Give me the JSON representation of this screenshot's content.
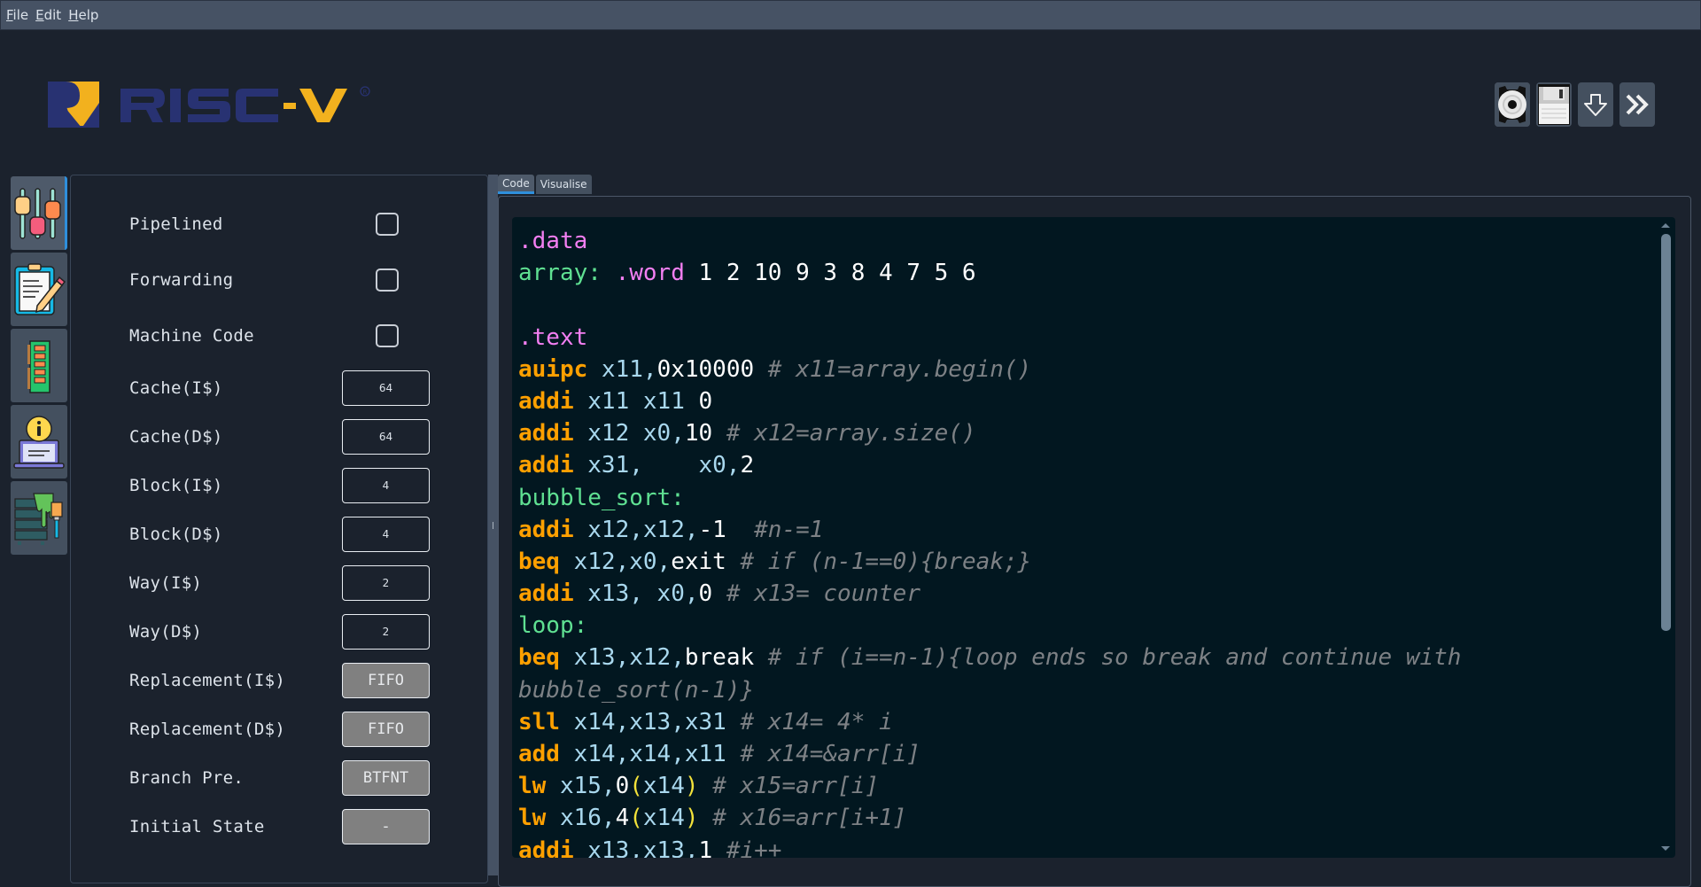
{
  "menu": [
    {
      "label": "File",
      "mnemonic": "F",
      "rest": "ile"
    },
    {
      "label": "Edit",
      "mnemonic": "E",
      "rest": "dit"
    },
    {
      "label": "Help",
      "mnemonic": "H",
      "rest": "elp"
    }
  ],
  "logo": {
    "text_blue": "RISC",
    "text_dash_v": "-V",
    "registered": "®",
    "colors": {
      "blue": "#283272",
      "gold": "#f2b11e"
    }
  },
  "toolbar": {
    "buttons": [
      {
        "name": "settings",
        "icon": "gear-icon"
      },
      {
        "name": "save",
        "icon": "floppy-disk-icon"
      },
      {
        "name": "step",
        "icon": "arrow-down-icon"
      },
      {
        "name": "run",
        "icon": "double-chevron-right-icon"
      }
    ]
  },
  "sidebar": {
    "tabs": [
      {
        "name": "settings",
        "icon": "sliders-icon",
        "active": true
      },
      {
        "name": "editor",
        "icon": "clipboard-pencil-icon",
        "active": false
      },
      {
        "name": "memory",
        "icon": "ram-chip-icon",
        "active": false
      },
      {
        "name": "info",
        "icon": "laptop-info-icon",
        "active": false
      },
      {
        "name": "theme",
        "icon": "server-paint-icon",
        "active": false
      }
    ]
  },
  "settings": {
    "pipelined": {
      "label": "Pipelined",
      "checked": false
    },
    "forwarding": {
      "label": "Forwarding",
      "checked": false
    },
    "machine_code": {
      "label": "Machine Code",
      "checked": false
    },
    "cache_i": {
      "label": "Cache(I$)",
      "value": "64"
    },
    "cache_d": {
      "label": "Cache(D$)",
      "value": "64"
    },
    "block_i": {
      "label": "Block(I$)",
      "value": "4"
    },
    "block_d": {
      "label": "Block(D$)",
      "value": "4"
    },
    "way_i": {
      "label": "Way(I$)",
      "value": "2"
    },
    "way_d": {
      "label": "Way(D$)",
      "value": "2"
    },
    "replacement_i": {
      "label": "Replacement(I$)",
      "value": "FIFO"
    },
    "replacement_d": {
      "label": "Replacement(D$)",
      "value": "FIFO"
    },
    "branch_pre": {
      "label": "Branch Pre.",
      "value": "BTFNT"
    },
    "initial_state": {
      "label": "Initial State",
      "value": "-"
    }
  },
  "tabs": [
    {
      "label": "Code",
      "active": true
    },
    {
      "label": "Visualise",
      "active": false
    }
  ],
  "code": {
    "lines": [
      [
        {
          "t": ".data",
          "c": "dir"
        }
      ],
      [
        {
          "t": "array:",
          "c": "lbl"
        },
        {
          "t": " "
        },
        {
          "t": ".word",
          "c": "dir"
        },
        {
          "t": " 1 2 10 9 3 8 4 7 5 6",
          "c": "num"
        }
      ],
      [],
      [
        {
          "t": ".text",
          "c": "dir"
        }
      ],
      [
        {
          "t": "auipc",
          "c": "op"
        },
        {
          "t": " x11,",
          "c": "reg"
        },
        {
          "t": "0x10000",
          "c": "num"
        },
        {
          "t": " "
        },
        {
          "t": "# x11=array.begin()",
          "c": "cmt"
        }
      ],
      [
        {
          "t": "addi",
          "c": "op"
        },
        {
          "t": " x11 x11 ",
          "c": "reg"
        },
        {
          "t": "0",
          "c": "num"
        }
      ],
      [
        {
          "t": "addi",
          "c": "op"
        },
        {
          "t": " x12 x0,",
          "c": "reg"
        },
        {
          "t": "10",
          "c": "num"
        },
        {
          "t": " "
        },
        {
          "t": "# x12=array.size()",
          "c": "cmt"
        }
      ],
      [
        {
          "t": "addi",
          "c": "op"
        },
        {
          "t": " x31,    x0,",
          "c": "reg"
        },
        {
          "t": "2",
          "c": "num"
        }
      ],
      [
        {
          "t": "bubble_sort:",
          "c": "lbl"
        }
      ],
      [
        {
          "t": "addi",
          "c": "op"
        },
        {
          "t": " x12,x12,",
          "c": "reg"
        },
        {
          "t": "-1",
          "c": "num"
        },
        {
          "t": "  "
        },
        {
          "t": "#n-=1",
          "c": "cmt"
        }
      ],
      [
        {
          "t": "beq",
          "c": "op"
        },
        {
          "t": " x12,x0,",
          "c": "reg"
        },
        {
          "t": "exit",
          "c": "sym"
        },
        {
          "t": " "
        },
        {
          "t": "# if (n-1==0){break;}",
          "c": "cmt"
        }
      ],
      [
        {
          "t": "addi",
          "c": "op"
        },
        {
          "t": " x13, x0,",
          "c": "reg"
        },
        {
          "t": "0",
          "c": "num"
        },
        {
          "t": " "
        },
        {
          "t": "# x13= counter",
          "c": "cmt"
        }
      ],
      [
        {
          "t": "loop:",
          "c": "lbl"
        }
      ],
      [
        {
          "t": "beq",
          "c": "op"
        },
        {
          "t": " x13,x12,",
          "c": "reg"
        },
        {
          "t": "break",
          "c": "sym"
        },
        {
          "t": " "
        },
        {
          "t": "# if (i==n-1){loop ends so break and continue with",
          "c": "cmt"
        }
      ],
      [
        {
          "t": "bubble_sort(n-1)}",
          "c": "cmt"
        }
      ],
      [
        {
          "t": "sll",
          "c": "op"
        },
        {
          "t": " x14,x13,x31 ",
          "c": "reg"
        },
        {
          "t": "# x14= 4* i",
          "c": "cmt"
        }
      ],
      [
        {
          "t": "add",
          "c": "op"
        },
        {
          "t": " x14,x14,x11 ",
          "c": "reg"
        },
        {
          "t": "# x14=&arr[i]",
          "c": "cmt"
        }
      ],
      [
        {
          "t": "lw",
          "c": "op"
        },
        {
          "t": " x15,",
          "c": "reg"
        },
        {
          "t": "0",
          "c": "num"
        },
        {
          "t": "(",
          "c": "paren"
        },
        {
          "t": "x14",
          "c": "reg"
        },
        {
          "t": ")",
          "c": "paren"
        },
        {
          "t": " "
        },
        {
          "t": "# x15=arr[i]",
          "c": "cmt"
        }
      ],
      [
        {
          "t": "lw",
          "c": "op"
        },
        {
          "t": " x16,",
          "c": "reg"
        },
        {
          "t": "4",
          "c": "num"
        },
        {
          "t": "(",
          "c": "paren"
        },
        {
          "t": "x14",
          "c": "reg"
        },
        {
          "t": ")",
          "c": "paren"
        },
        {
          "t": " "
        },
        {
          "t": "# x16=arr[i+1]",
          "c": "cmt"
        }
      ],
      [
        {
          "t": "addi",
          "c": "op"
        },
        {
          "t": " x13,x13,",
          "c": "reg"
        },
        {
          "t": "1",
          "c": "num"
        },
        {
          "t": " "
        },
        {
          "t": "#i++",
          "c": "cmt"
        }
      ]
    ],
    "syntax_colors": {
      "directive": "#f37ff2",
      "label": "#5fe092",
      "opcode": "#ffa000",
      "register": "#a9d8ee",
      "number": "#ffffff",
      "paren": "#f3e23a",
      "comment": "#7d8185"
    }
  }
}
